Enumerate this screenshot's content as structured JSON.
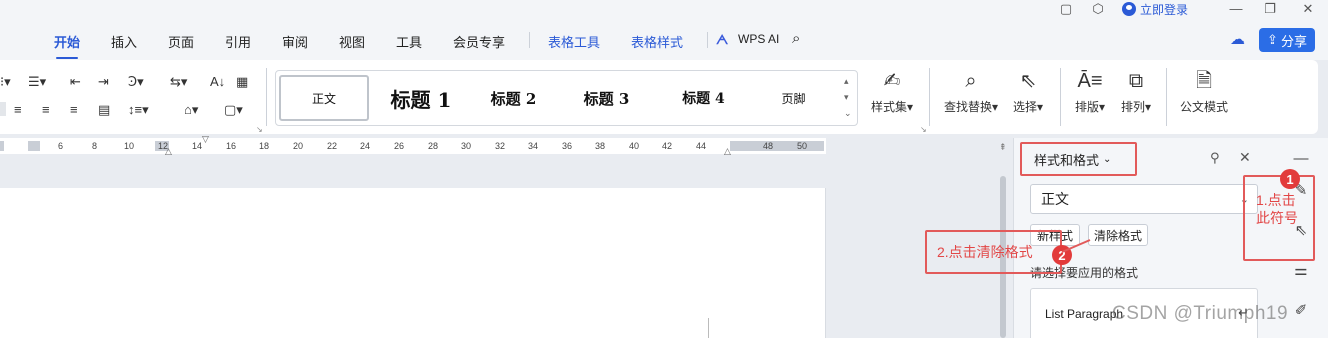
{
  "titlebar": {
    "login_label": "立即登录"
  },
  "menu": {
    "tabs": [
      "开始",
      "插入",
      "页面",
      "引用",
      "审阅",
      "视图",
      "工具",
      "会员专享"
    ],
    "context_tabs": [
      "表格工具",
      "表格样式"
    ],
    "wps_ai": "WPS AI",
    "share_label": "分享"
  },
  "ribbon": {
    "styles": [
      "正文",
      "标题 1",
      "标题 2",
      "标题 3",
      "标题 4",
      "页脚"
    ],
    "style_set": "样式集",
    "find_replace": "查找替换",
    "select": "选择",
    "typeset": "排版",
    "arrange": "排列",
    "official_mode": "公文模式"
  },
  "ruler": {
    "ticks": [
      "6",
      "8",
      "10",
      "12",
      "14",
      "16",
      "18",
      "20",
      "22",
      "24",
      "26",
      "28",
      "30",
      "32",
      "34",
      "36",
      "38",
      "40",
      "42",
      "44",
      "48",
      "50"
    ]
  },
  "pane": {
    "title": "样式和格式",
    "current_style": "正文",
    "new_style": "新样式",
    "clear_format": "清除格式",
    "hint": "请选择要应用的格式",
    "list_items": [
      "List Paragraph"
    ]
  },
  "annotations": {
    "step1": "1.点击此符号",
    "step2": "2.点击清除格式",
    "badge1": "1",
    "badge2": "2"
  },
  "watermark": "CSDN @Triumph19",
  "colors": {
    "accent": "#2b5ad6",
    "annotation": "#e25a5a"
  }
}
